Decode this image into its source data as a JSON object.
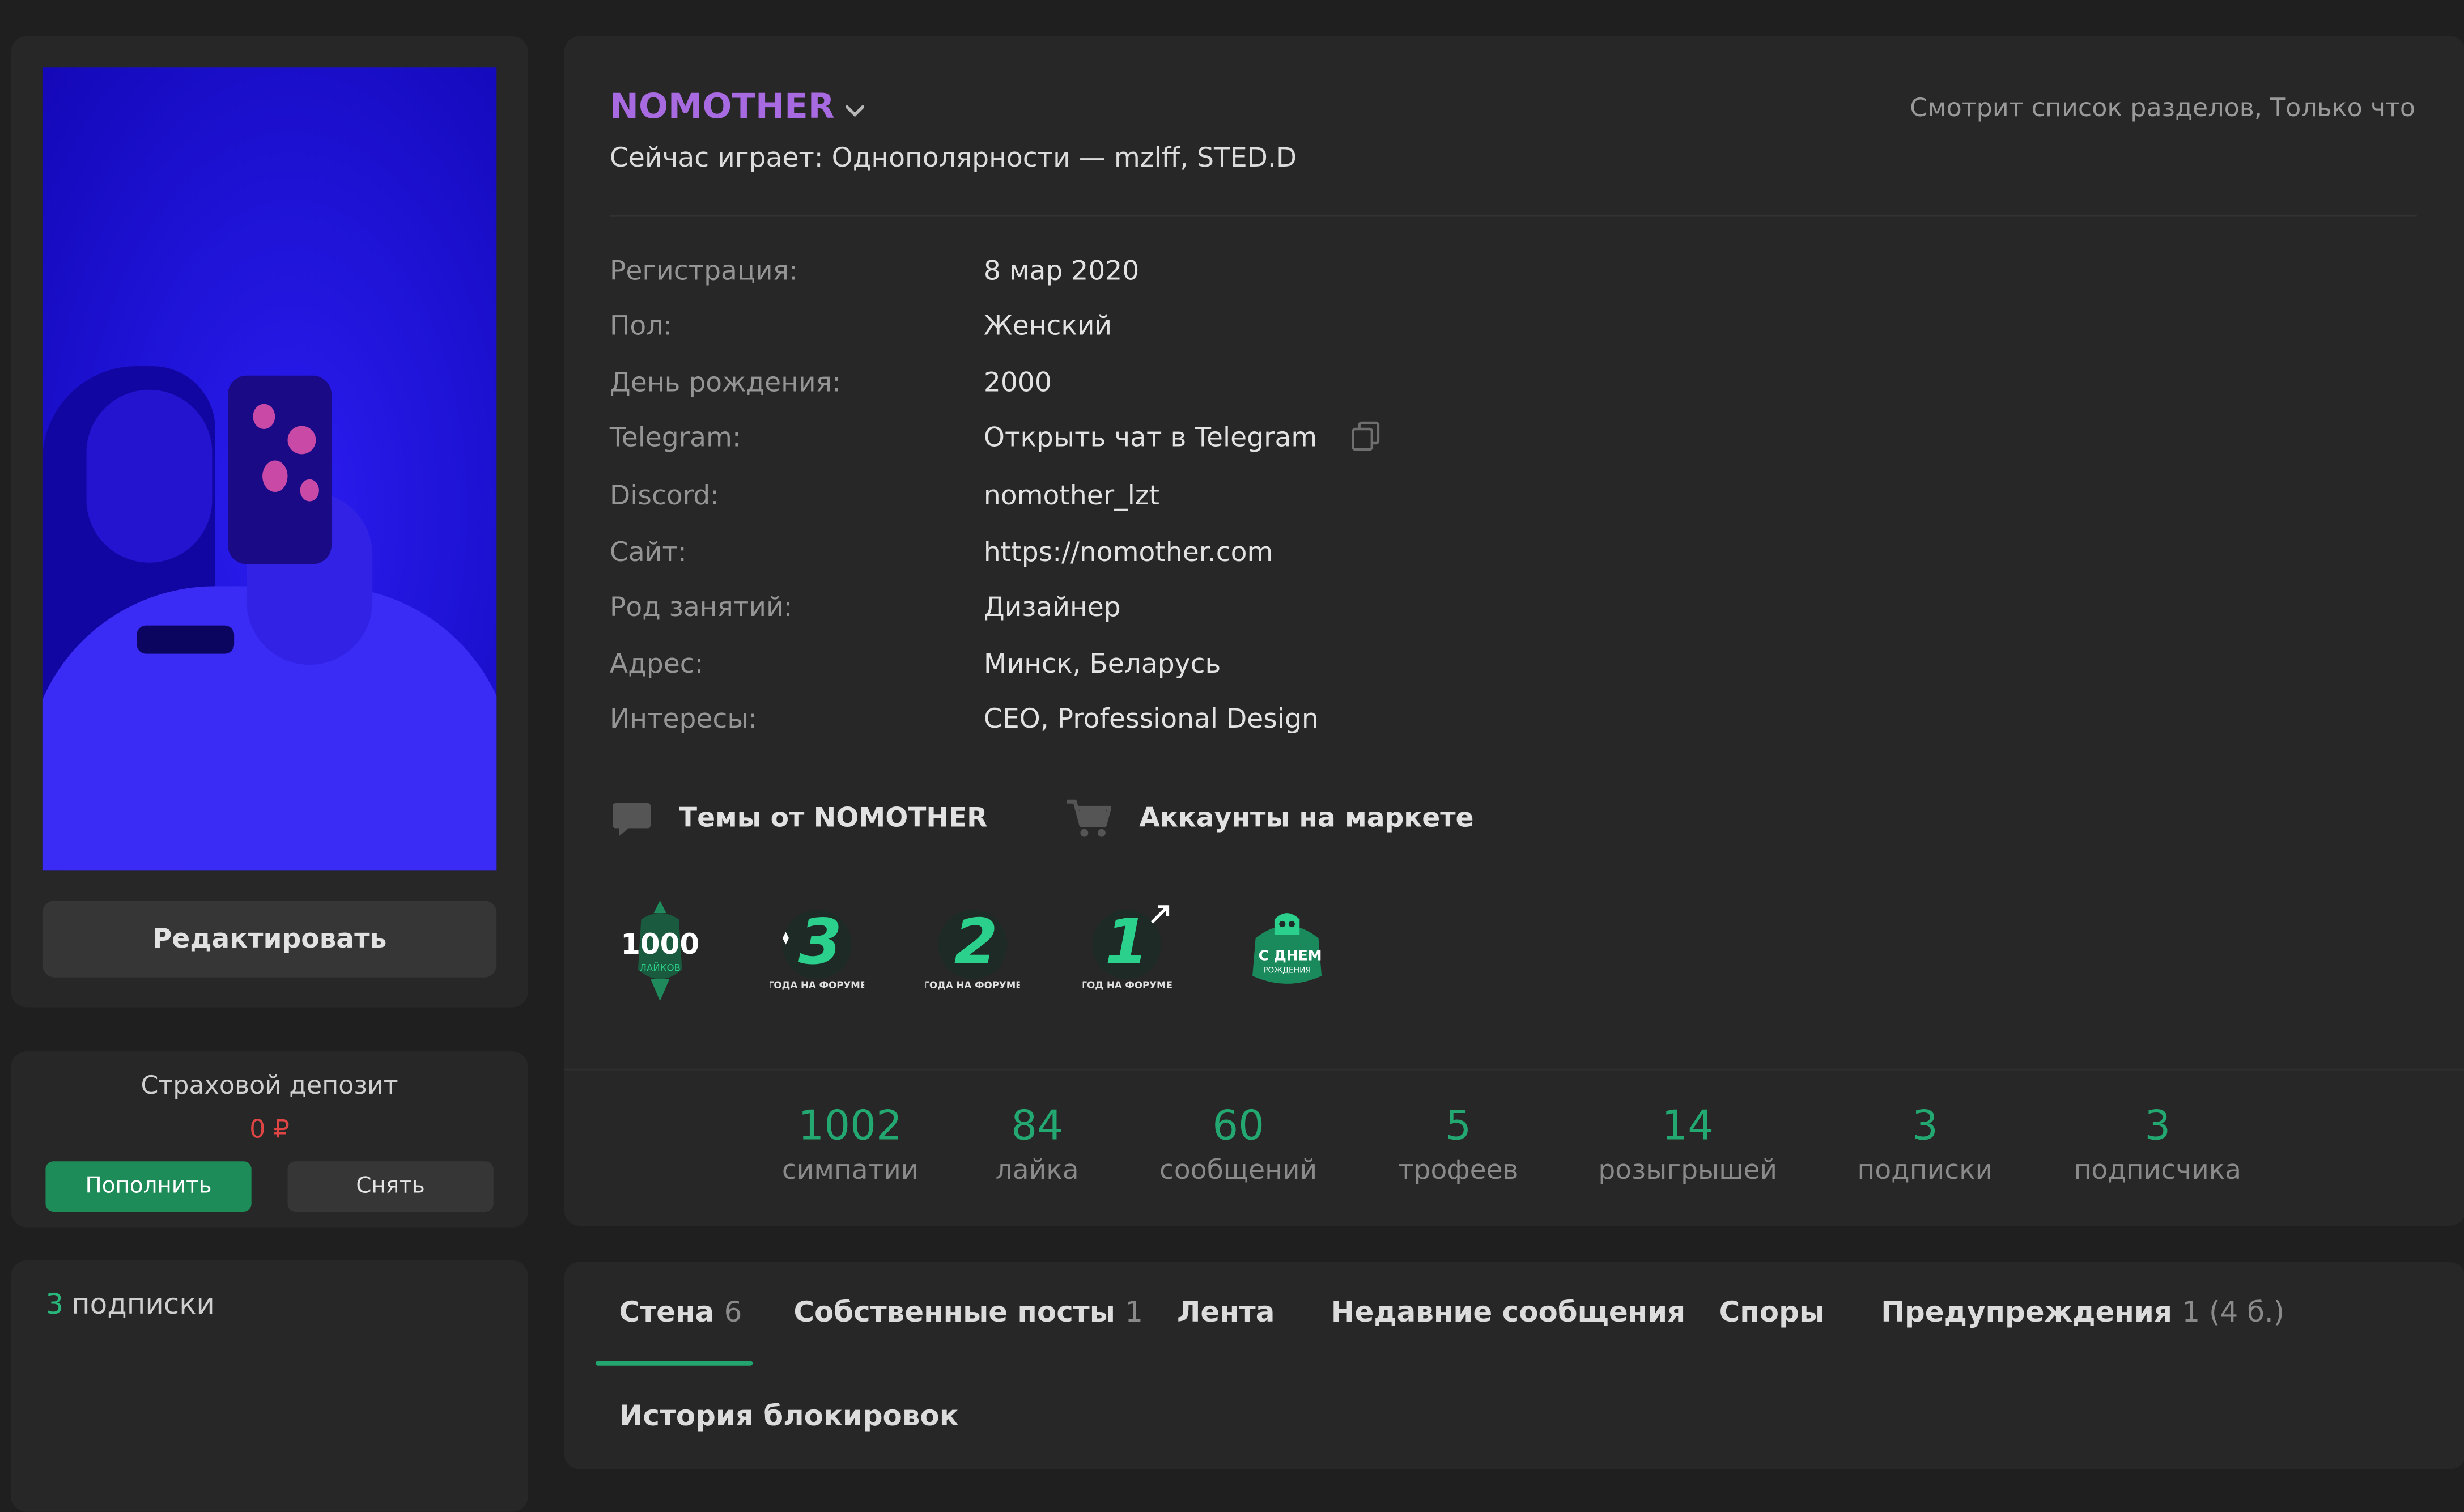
{
  "profile": {
    "username": "NOMOTHER",
    "activity": "Смотрит список разделов, Только что",
    "now_playing": "Сейчас играет: Однополярности — mzlff, STED.D",
    "fields": [
      {
        "label": "Регистрация:",
        "value": "8 мар 2020"
      },
      {
        "label": "Пол:",
        "value": "Женский"
      },
      {
        "label": "День рождения:",
        "value": "2000"
      },
      {
        "label": "Telegram:",
        "value": "Открыть чат в Telegram"
      },
      {
        "label": "Discord:",
        "value": "nomother_lzt"
      },
      {
        "label": "Сайт:",
        "value": "https://nomother.com"
      },
      {
        "label": "Род занятий:",
        "value": "Дизайнер"
      },
      {
        "label": "Адрес:",
        "value": "Минск, Беларусь"
      },
      {
        "label": "Интересы:",
        "value": "CEO, Professional Design"
      }
    ],
    "links": {
      "threads": "Темы от NOMOTHER",
      "market": "Аккаунты на маркете"
    }
  },
  "trophies": [
    {
      "icon": "trophy-1000-likes-icon",
      "text": "1000",
      "sub": "ЛАЙКОВ"
    },
    {
      "icon": "trophy-3-years-icon",
      "text": "3",
      "sub": "ГОДА НА ФОРУМЕ"
    },
    {
      "icon": "trophy-2-years-icon",
      "text": "2",
      "sub": "ГОДА НА ФОРУМЕ"
    },
    {
      "icon": "trophy-1-year-icon",
      "text": "1",
      "sub": "ГОД НА ФОРУМЕ"
    },
    {
      "icon": "trophy-birthday-icon",
      "text": "С ДНЕМ",
      "sub": "РОЖДЕНИЯ"
    }
  ],
  "stats": [
    {
      "value": "1002",
      "label": "симпатии"
    },
    {
      "value": "84",
      "label": "лайка"
    },
    {
      "value": "60",
      "label": "сообщений"
    },
    {
      "value": "5",
      "label": "трофеев"
    },
    {
      "value": "14",
      "label": "розыгрышей"
    },
    {
      "value": "3",
      "label": "подписки"
    },
    {
      "value": "3",
      "label": "подписчика"
    }
  ],
  "sidebar": {
    "edit_label": "Редактировать",
    "deposit_title": "Страховой депозит",
    "deposit_amount": "0 ₽",
    "topup_label": "Пополнить",
    "withdraw_label": "Снять",
    "subscriptions_count": "3",
    "subscriptions_label": "подписки"
  },
  "tabs": [
    {
      "label": "Стена",
      "count": "6"
    },
    {
      "label": "Собственные посты",
      "count": "1"
    },
    {
      "label": "Лента",
      "count": ""
    },
    {
      "label": "Недавние сообщения",
      "count": ""
    },
    {
      "label": "Споры",
      "count": ""
    },
    {
      "label": "Предупреждения",
      "count": "1 (4 б.)"
    },
    {
      "label": "История блокировок",
      "count": ""
    }
  ],
  "colors": {
    "accent_green": "#24a872",
    "username_purple": "#a86ae0",
    "deposit_red": "#e04545",
    "background": "#1f1f1f",
    "card": "#272727"
  }
}
